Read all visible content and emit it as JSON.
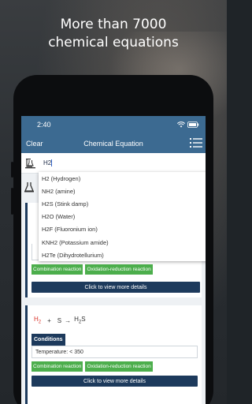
{
  "promo": {
    "line1": "More than 7000",
    "line2": "chemical equations"
  },
  "status": {
    "time": "2:40"
  },
  "navbar": {
    "clear_label": "Clear",
    "title": "Chemical Equation",
    "menu_icon": "hamburger-list-icon"
  },
  "search": {
    "value": "H2",
    "icon": "flask-icon"
  },
  "suggestions": [
    "H2 (Hydrogen)",
    "NH2 (amine)",
    "H2S (Stink damp)",
    "H2O (Water)",
    "H2F (Fluoronium ion)",
    "KNH2 (Potassium amide)",
    "H2Te (Dihydrotellurium)"
  ],
  "card1": {
    "tags": [
      "Combination reaction",
      "Oxidation-reduction reaction"
    ],
    "details_label": "Click to view more details"
  },
  "card2": {
    "reactant1": "H",
    "reactant1_sub": "2",
    "plus": "+",
    "reactant2": "S",
    "arrow": "→",
    "product": "H",
    "product_sub": "2",
    "product_tail": "S",
    "conditions_label": "Conditions",
    "condition_text": "Temperature: < 350",
    "tags": [
      "Combination reaction",
      "Oxidation-reduction reaction"
    ],
    "details_label": "Click to view more details"
  },
  "colors": {
    "header": "#3c6a91",
    "navy": "#1d3a5c",
    "tag_green": "#4cae4c",
    "reactant_red": "#d9342b"
  }
}
